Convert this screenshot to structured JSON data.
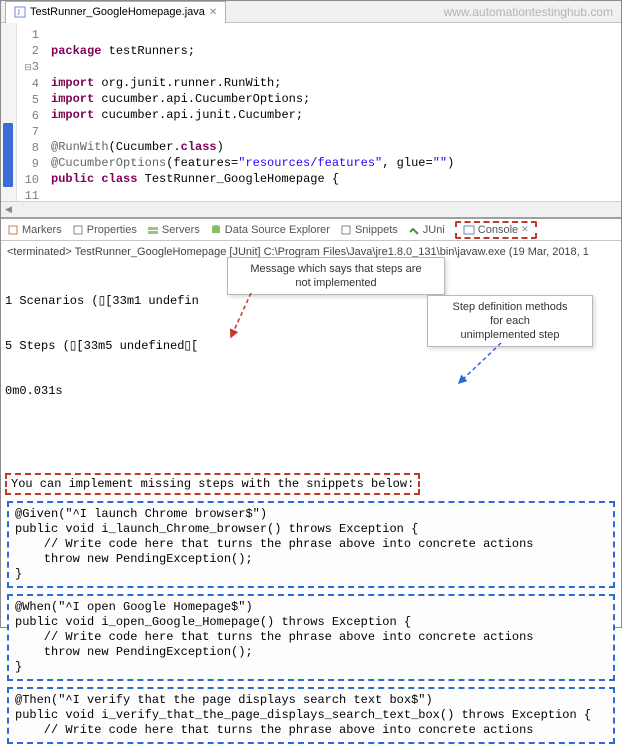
{
  "watermark": "www.automationtestinghub.com",
  "editor_tab": {
    "filename": "TestRunner_GoogleHomepage.java"
  },
  "code_lines": {
    "l1p": "package",
    "l1r": " testRunners;",
    "l3p": "import",
    "l3r": " org.junit.runner.RunWith;",
    "l4p": "import",
    "l4r": " cucumber.api.CucumberOptions;",
    "l5p": "import",
    "l5r": " cucumber.api.junit.Cucumber;",
    "l7a": "@RunWith",
    "l7r": "(Cucumber.",
    "l7c": "class",
    "l7e": ")",
    "l8a": "@CucumberOptions",
    "l8b": "(features=",
    "l8s1": "\"resources/features\"",
    "l8c": ", glue=",
    "l8s2": "\"\"",
    "l8d": ")",
    "l9a": "public",
    "l9b": " class",
    "l9c": " TestRunner_GoogleHomepage {",
    "l11": "}"
  },
  "gutter": [
    "1",
    "2",
    "3",
    "4",
    "5",
    "6",
    "7",
    "8",
    "9",
    "10",
    "11"
  ],
  "gutter3_prefix": "3",
  "views": {
    "markers": "Markers",
    "properties": "Properties",
    "servers": "Servers",
    "dse": "Data Source Explorer",
    "snippets": "Snippets",
    "junit": "JUni",
    "console": "Console"
  },
  "terminated": "<terminated> TestRunner_GoogleHomepage [JUnit] C:\\Program Files\\Java\\jre1.8.0_131\\bin\\javaw.exe (19 Mar, 2018, 1",
  "summary": {
    "scenarios": "1 Scenarios (▯[33m1 undefin",
    "steps": "5 Steps (▯[33m5 undefined▯[",
    "time": "0m0.031s"
  },
  "callout1": "Message which says that steps are\nnot implemented",
  "callout2": "Step definition methods\nfor each\nunimplemented step",
  "hint": "You can implement missing steps with the snippets below:",
  "snippets_code": {
    "s1": "@Given(\"^I launch Chrome browser$\")\npublic void i_launch_Chrome_browser() throws Exception {\n    // Write code here that turns the phrase above into concrete actions\n    throw new PendingException();\n}",
    "s2": "@When(\"^I open Google Homepage$\")\npublic void i_open_Google_Homepage() throws Exception {\n    // Write code here that turns the phrase above into concrete actions\n    throw new PendingException();\n}",
    "s3": "@Then(\"^I verify that the page displays search text box$\")\npublic void i_verify_that_the_page_displays_search_text_box() throws Exception {\n    // Write code here that turns the phrase above into concrete actions"
  }
}
